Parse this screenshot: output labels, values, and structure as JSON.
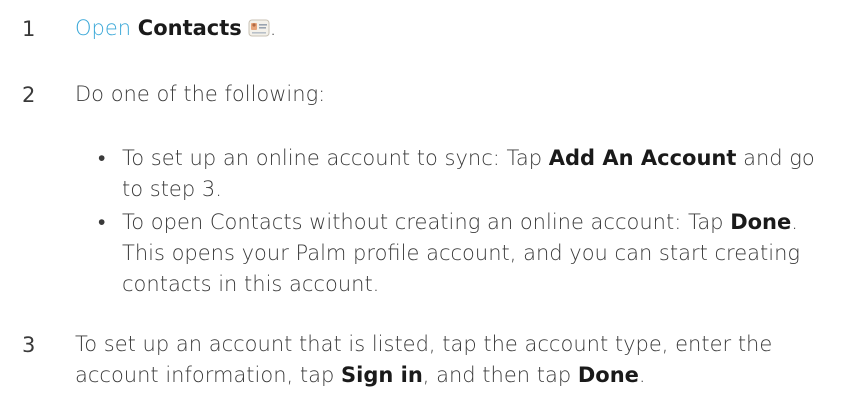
{
  "steps": [
    {
      "number": "1",
      "link": "Open",
      "bold": "Contacts",
      "after_icon": ".",
      "icon": "contacts-app-icon"
    },
    {
      "number": "2",
      "text": "Do one of the following:"
    },
    {
      "number": "3",
      "text_a": "To set up an account that is listed, tap the account type, enter the account information, tap ",
      "bold_a": "Sign in",
      "text_b": ", and then tap ",
      "bold_b": "Done",
      "text_c": "."
    }
  ],
  "bullets": [
    {
      "dot": "•",
      "text_a": "To set up an online account to sync: Tap ",
      "bold": "Add An Account",
      "text_b": " and go to step 3."
    },
    {
      "dot": "•",
      "text_a": "To open Contacts without creating an online account: Tap ",
      "bold": "Done",
      "text_b": ". This opens your Palm profile account, and you can start creating contacts in this account."
    }
  ]
}
